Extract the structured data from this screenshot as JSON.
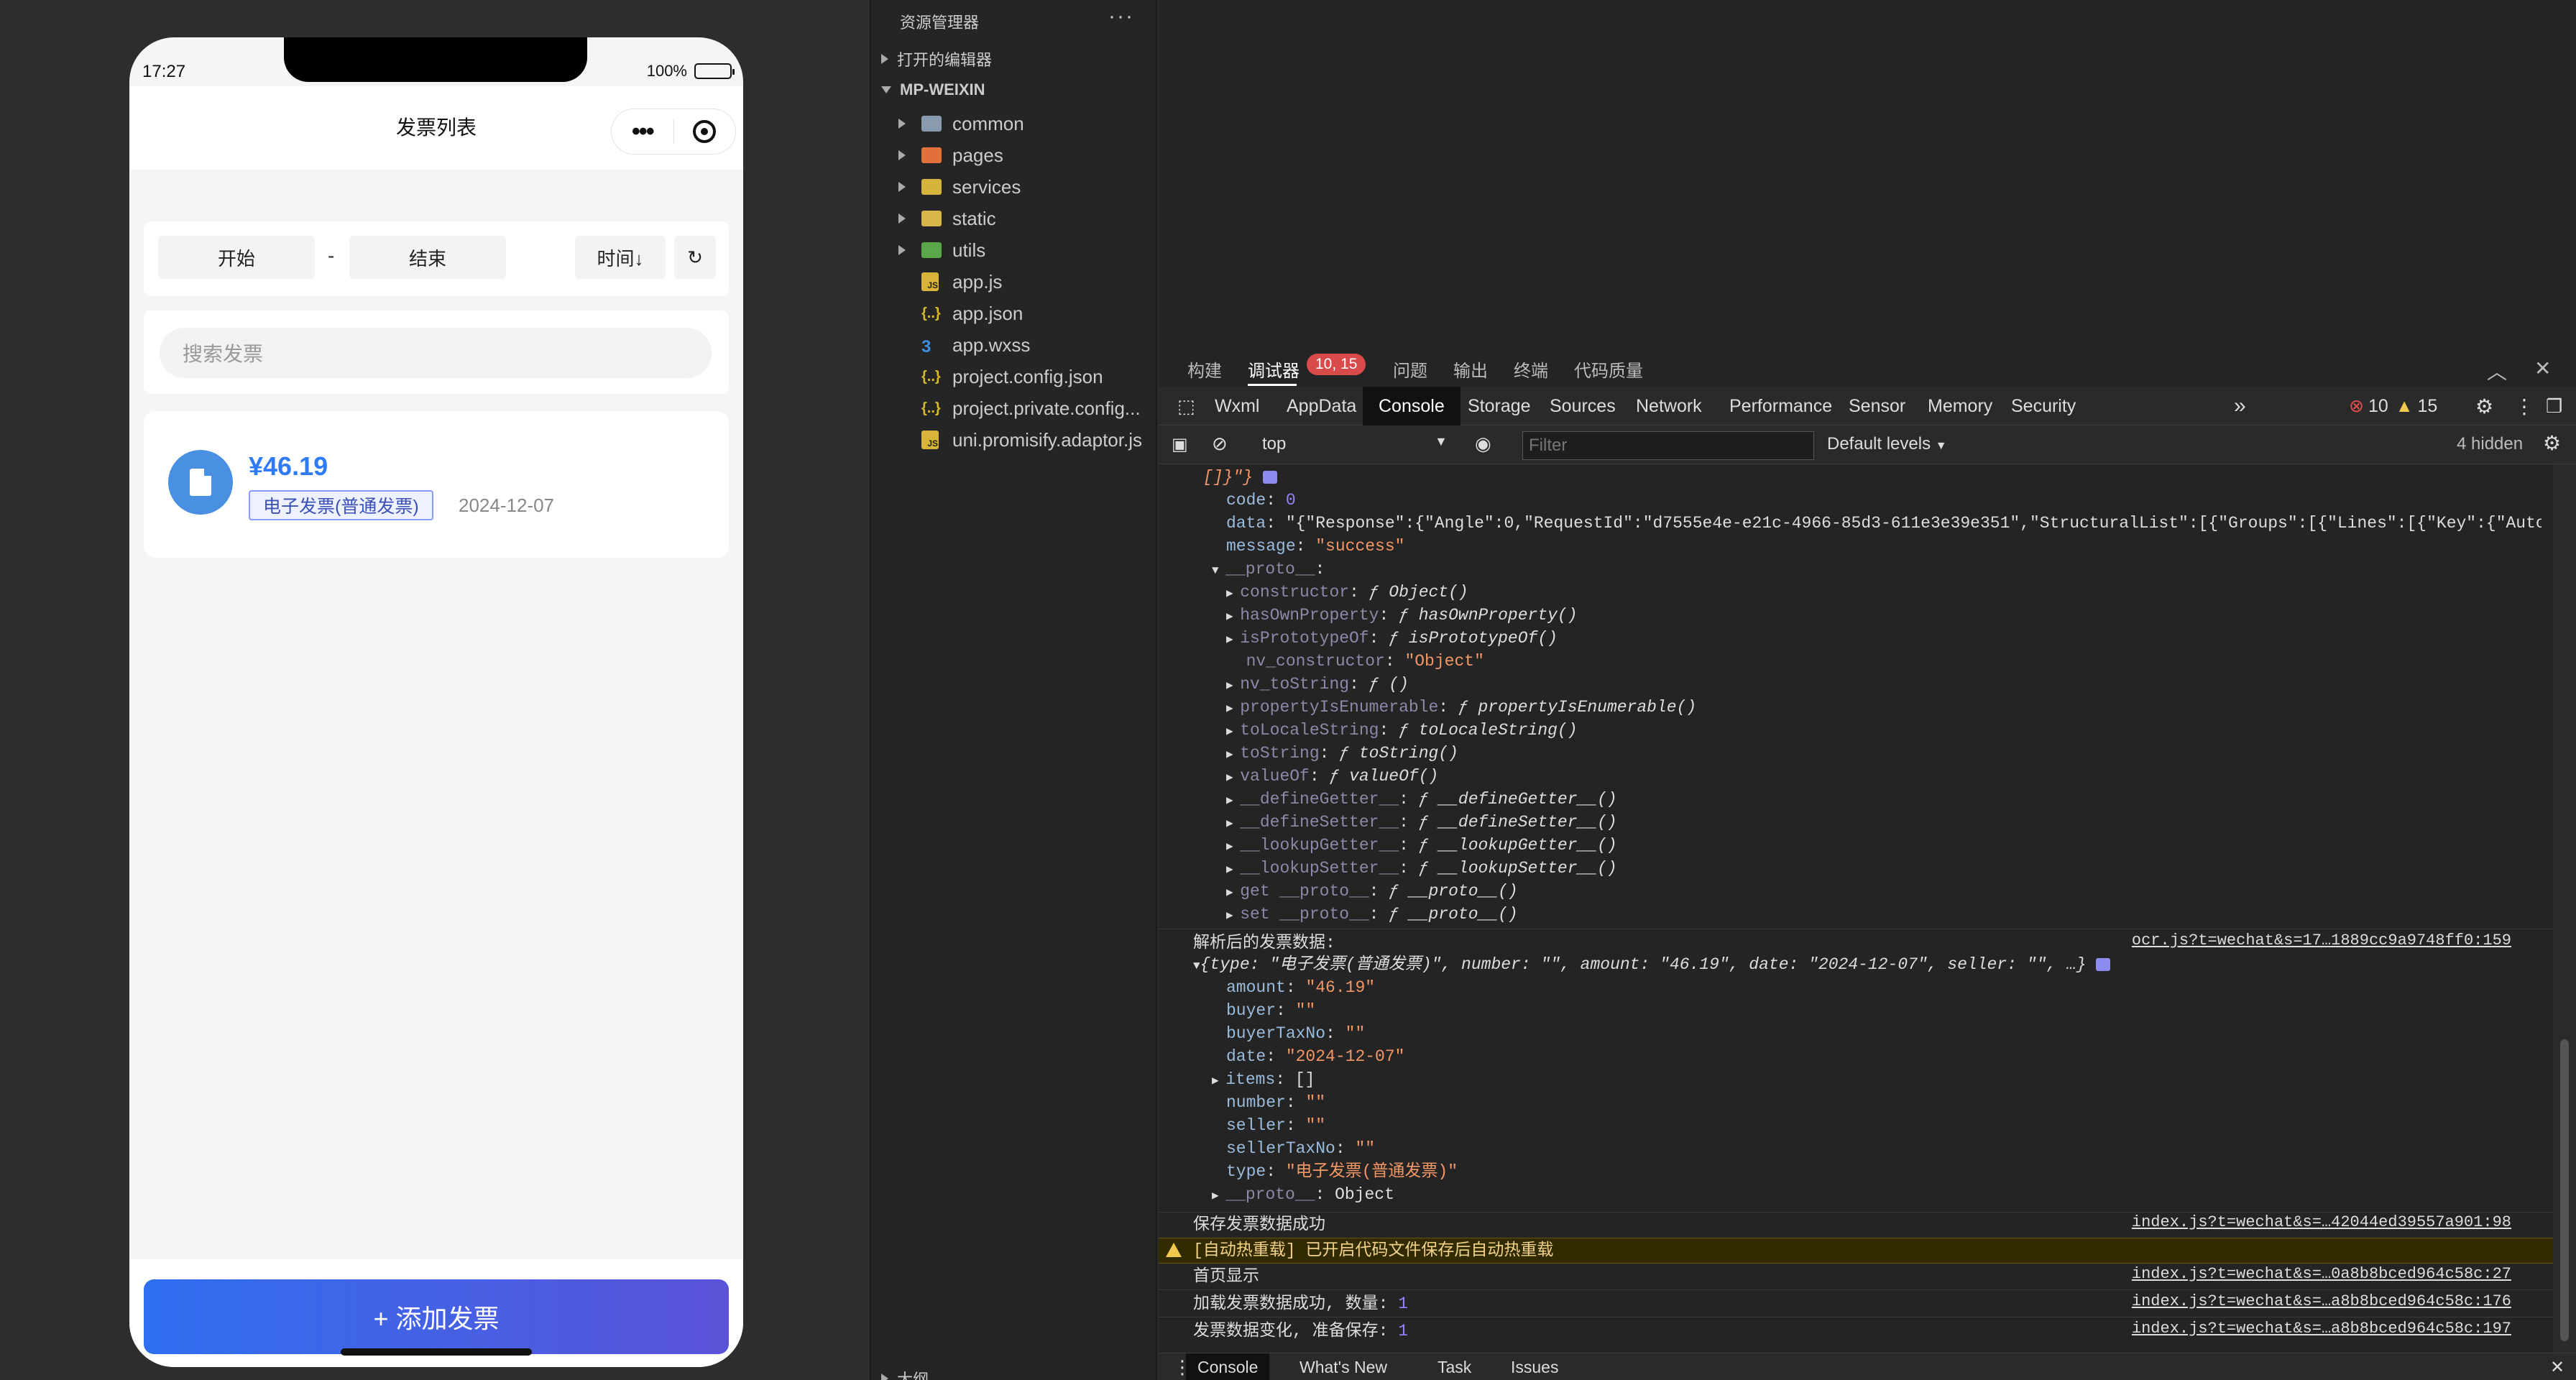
{
  "phone": {
    "time": "17:27",
    "battery": "100%",
    "battery_level": 1.0,
    "title": "发票列表",
    "filter": {
      "start": "开始",
      "dash": "-",
      "end": "结束",
      "sort": "时间↓",
      "refresh": "↻"
    },
    "search_placeholder": "搜索发票",
    "invoice": {
      "amount": "¥46.19",
      "type": "电子发票(普通发票)",
      "date": "2024-12-07"
    },
    "add_button": "+ 添加发票"
  },
  "explorer": {
    "title": "资源管理器",
    "more": "···",
    "open_editors": "打开的编辑器",
    "project": "MP-WEIXIN",
    "folders": [
      "common",
      "pages",
      "services",
      "static",
      "utils"
    ],
    "files": [
      "app.js",
      "app.json",
      "app.wxss",
      "project.config.json",
      "project.private.config...",
      "uni.promisify.adaptor.js"
    ],
    "outline": "大纲"
  },
  "devtools": {
    "top_tabs": [
      "构建",
      "调试器",
      "问题",
      "输出",
      "终端",
      "代码质量"
    ],
    "badge": "10, 15",
    "panels": [
      "Wxml",
      "AppData",
      "Console",
      "Storage",
      "Sources",
      "Network",
      "Performance",
      "Sensor",
      "Memory",
      "Security"
    ],
    "more_panels": "»",
    "errors": "10",
    "warnings": "15",
    "context": "top",
    "filter_placeholder": "Filter",
    "levels": "Default levels",
    "hidden": "4 hidden",
    "drawer_tabs": [
      "Console",
      "What's New",
      "Task",
      "Issues"
    ]
  },
  "console": {
    "top_line": "[]}\"}",
    "code": "0",
    "data_value": "\"{\"Response\":{\"Angle\":0,\"RequestId\":\"d7555e4e-e21c-4966-85d3-611e3e39e351\",\"StructuralList\":[{\"Groups\":[{\"Lines\":[{\"Key\":{\"AutoNa…",
    "message_value": "\"success\"",
    "proto": "__proto__",
    "proto_members": [
      {
        "k": "constructor",
        "v": "Object()"
      },
      {
        "k": "hasOwnProperty",
        "v": "hasOwnProperty()"
      },
      {
        "k": "isPrototypeOf",
        "v": "isPrototypeOf()"
      },
      {
        "k": "nv_constructor",
        "v": "\"Object\""
      },
      {
        "k": "nv_toString",
        "v": "()"
      },
      {
        "k": "propertyIsEnumerable",
        "v": "propertyIsEnumerable()"
      },
      {
        "k": "toLocaleString",
        "v": "toLocaleString()"
      },
      {
        "k": "toString",
        "v": "toString()"
      },
      {
        "k": "valueOf",
        "v": "valueOf()"
      },
      {
        "k": "__defineGetter__",
        "v": "__defineGetter__()"
      },
      {
        "k": "__defineSetter__",
        "v": "__defineSetter__()"
      },
      {
        "k": "__lookupGetter__",
        "v": "__lookupGetter__()"
      },
      {
        "k": "__lookupSetter__",
        "v": "__lookupSetter__()"
      },
      {
        "k": "get __proto__",
        "v": "__proto__()"
      },
      {
        "k": "set __proto__",
        "v": "__proto__()"
      }
    ],
    "parsed_label": "解析后的发票数据:",
    "parsed_link": "ocr.js?t=wechat&s=17…1889cc9a9748ff0:159",
    "parsed_summary": "{type: \"电子发票(普通发票)\", number: \"\", amount: \"46.19\", date: \"2024-12-07\", seller: \"\", …}",
    "parsed_fields": [
      {
        "k": "amount",
        "v": "\"46.19\""
      },
      {
        "k": "buyer",
        "v": "\"\""
      },
      {
        "k": "buyerTaxNo",
        "v": "\"\""
      },
      {
        "k": "date",
        "v": "\"2024-12-07\""
      },
      {
        "k": "items",
        "v": "[]"
      },
      {
        "k": "number",
        "v": "\"\""
      },
      {
        "k": "seller",
        "v": "\"\""
      },
      {
        "k": "sellerTaxNo",
        "v": "\"\""
      },
      {
        "k": "type",
        "v": "\"电子发票(普通发票)\""
      },
      {
        "k": "__proto__",
        "v": "Object"
      }
    ],
    "logs": [
      {
        "text": "保存发票数据成功",
        "link": "index.js?t=wechat&s=…42044ed39557a901:98"
      },
      {
        "text": "[自动热重载] 已开启代码文件保存后自动热重载",
        "link": ""
      },
      {
        "text": "首页显示",
        "link": "index.js?t=wechat&s=…0a8b8bced964c58c:27"
      },
      {
        "text": "加载发票数据成功, 数量:",
        "num": "1",
        "link": "index.js?t=wechat&s=…a8b8bced964c58c:176"
      },
      {
        "text": "发票数据变化, 准备保存:",
        "num": "1",
        "link": "index.js?t=wechat&s=…a8b8bced964c58c:197"
      }
    ]
  }
}
